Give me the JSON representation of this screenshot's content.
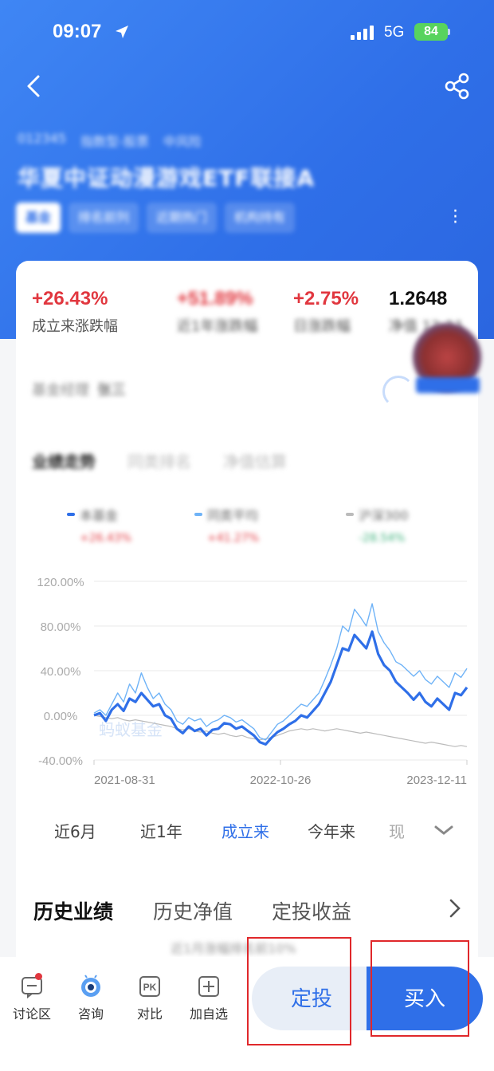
{
  "status": {
    "time": "09:07",
    "network": "5G",
    "battery": "84"
  },
  "fund": {
    "code_row": [
      "012345",
      "指数型-股票",
      "中风险"
    ],
    "name": "华夏中证动漫游戏ETF联接A",
    "tags": [
      "基金",
      "排名前列",
      "近期热门",
      "机构持有"
    ]
  },
  "stats": [
    {
      "value": "+26.43%",
      "label": "成立来涨跌幅",
      "color": "#e1373f"
    },
    {
      "value": "+51.89%",
      "label": "近1年涨跌幅",
      "color": "#e1373f"
    },
    {
      "value": "+2.75%",
      "label": "日涨跌幅",
      "color": "#e1373f"
    },
    {
      "value": "1.2648",
      "label": "净值 12-11",
      "color": "#111111"
    }
  ],
  "info": {
    "label": "基金经理",
    "value": "张三"
  },
  "chart_tabs": [
    "业绩走势",
    "同类排名",
    "净值估算"
  ],
  "legend": [
    {
      "name": "本基金",
      "pct": "+26.43%",
      "color": "#2f6fe8"
    },
    {
      "name": "同类平均",
      "pct": "+41.27%",
      "color": "#6fb3f7"
    },
    {
      "name": "沪深300",
      "pct": "-28.54%",
      "color": "#bbbbbb"
    }
  ],
  "chart_data": {
    "type": "line",
    "watermark": "蚂蚁基金",
    "y_ticks": [
      "120.00%",
      "80.00%",
      "40.00%",
      "0.00%",
      "-40.00%"
    ],
    "ylim": [
      -40,
      120
    ],
    "x_ticks": [
      "2021-08-31",
      "2022-10-26",
      "2023-12-11"
    ],
    "series": [
      {
        "name": "本基金",
        "color": "#2f6fe8",
        "values": [
          0,
          2,
          -5,
          5,
          10,
          4,
          15,
          12,
          20,
          14,
          8,
          10,
          0,
          -3,
          -12,
          -16,
          -10,
          -14,
          -12,
          -18,
          -13,
          -12,
          -7,
          -8,
          -12,
          -10,
          -14,
          -18,
          -24,
          -26,
          -20,
          -15,
          -12,
          -8,
          -5,
          0,
          -2,
          4,
          10,
          20,
          30,
          45,
          60,
          58,
          72,
          66,
          60,
          75,
          55,
          45,
          40,
          30,
          25,
          20,
          14,
          20,
          12,
          8,
          15,
          10,
          5,
          20,
          18,
          25
        ]
      },
      {
        "name": "同类平均",
        "color": "#6fb3f7",
        "values": [
          2,
          5,
          0,
          10,
          20,
          12,
          28,
          20,
          38,
          25,
          15,
          20,
          10,
          5,
          -5,
          -8,
          -2,
          -5,
          -3,
          -10,
          -6,
          -4,
          0,
          -2,
          -6,
          -4,
          -8,
          -12,
          -20,
          -22,
          -15,
          -8,
          -5,
          0,
          5,
          10,
          8,
          14,
          20,
          32,
          45,
          60,
          80,
          75,
          95,
          88,
          80,
          100,
          75,
          65,
          58,
          48,
          45,
          40,
          35,
          40,
          32,
          28,
          35,
          30,
          25,
          38,
          34,
          42
        ]
      },
      {
        "name": "沪深300",
        "color": "#bbbbbb",
        "values": [
          0,
          -1,
          -2,
          -3,
          -2,
          -4,
          -5,
          -4,
          -5,
          -6,
          -7,
          -8,
          -9,
          -10,
          -12,
          -13,
          -12,
          -14,
          -15,
          -14,
          -16,
          -17,
          -16,
          -18,
          -19,
          -18,
          -20,
          -21,
          -22,
          -21,
          -20,
          -18,
          -16,
          -14,
          -13,
          -12,
          -13,
          -12,
          -13,
          -14,
          -13,
          -12,
          -13,
          -14,
          -15,
          -16,
          -15,
          -16,
          -17,
          -18,
          -19,
          -20,
          -21,
          -22,
          -23,
          -24,
          -25,
          -24,
          -25,
          -26,
          -27,
          -28,
          -27,
          -28
        ]
      }
    ]
  },
  "range_tabs": [
    {
      "label": "近6月",
      "state": "normal"
    },
    {
      "label": "近1年",
      "state": "normal"
    },
    {
      "label": "成立来",
      "state": "active"
    },
    {
      "label": "今年来",
      "state": "normal"
    },
    {
      "label": "现",
      "state": "faded"
    }
  ],
  "section_tabs": [
    "历史业绩",
    "历史净值",
    "定投收益"
  ],
  "perf_hint": "近1月涨幅排名前10%",
  "bottom_actions": [
    {
      "label": "讨论区",
      "icon": "discussion-icon"
    },
    {
      "label": "咨询",
      "icon": "consult-icon"
    },
    {
      "label": "对比",
      "icon": "pk-icon"
    },
    {
      "label": "加自选",
      "icon": "add-watchlist-icon"
    }
  ],
  "buttons": {
    "sip": "定投",
    "buy": "买入"
  }
}
